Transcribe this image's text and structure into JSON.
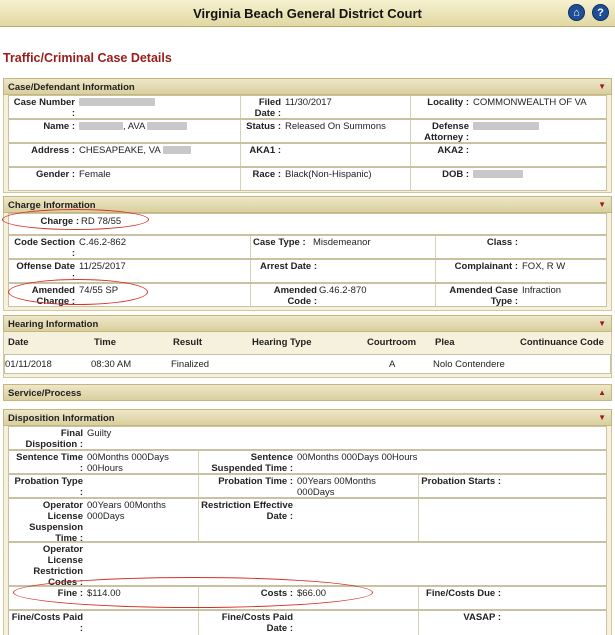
{
  "header": {
    "title": "Virginia Beach General District Court",
    "home_icon": "house-icon",
    "help_icon": "question-icon"
  },
  "page_title": "Traffic/Criminal Case Details",
  "case_section": {
    "title": "Case/Defendant Information",
    "case_number_label": "Case Number :",
    "case_number_value": "",
    "filed_date_label": "Filed Date :",
    "filed_date_value": "11/30/2017",
    "locality_label": "Locality :",
    "locality_value": "COMMONWEALTH OF VA",
    "name_label": "Name :",
    "name_value": ", AVA",
    "status_label": "Status :",
    "status_value": "Released On Summons",
    "defense_attorney_label": "Defense Attorney :",
    "address_label": "Address :",
    "address_value": "CHESAPEAKE, VA",
    "aka1_label": "AKA1 :",
    "aka2_label": "AKA2 :",
    "gender_label": "Gender :",
    "gender_value": "Female",
    "race_label": "Race :",
    "race_value": "Black(Non-Hispanic)",
    "dob_label": "DOB :"
  },
  "charge_section": {
    "title": "Charge Information",
    "charge_label": "Charge :",
    "charge_value": "RD 78/55",
    "code_section_label": "Code Section :",
    "code_section_value": "C.46.2-862",
    "case_type_label": "Case Type :",
    "case_type_value": "Misdemeanor",
    "class_label": "Class :",
    "offense_date_label": "Offense Date :",
    "offense_date_value": "11/25/2017",
    "arrest_date_label": "Arrest Date :",
    "complainant_label": "Complainant :",
    "complainant_value": "FOX, R W",
    "amended_charge_label": "Amended Charge :",
    "amended_charge_value": "74/55 SP",
    "amended_code_label": "Amended Code :",
    "amended_code_value": "G.46.2-870",
    "amended_case_type_label": "Amended Case Type :",
    "amended_case_type_value": "Infraction"
  },
  "hearing_section": {
    "title": "Hearing Information",
    "columns": [
      "Date",
      "Time",
      "Result",
      "Hearing Type",
      "Courtroom",
      "Plea",
      "Continuance Code"
    ],
    "rows": [
      [
        "01/11/2018",
        "08:30 AM",
        "Finalized",
        "",
        "A",
        "Nolo Contendere",
        ""
      ]
    ]
  },
  "service_section": {
    "title": "Service/Process"
  },
  "disposition_section": {
    "title": "Disposition Information",
    "final_disposition_label": "Final Disposition :",
    "final_disposition_value": "Guilty",
    "sentence_time_label": "Sentence Time :",
    "sentence_time_value": "00Months 000Days 00Hours",
    "sentence_suspended_label": "Sentence Suspended Time :",
    "sentence_suspended_value": "00Months 000Days 00Hours",
    "probation_type_label": "Probation Type :",
    "probation_time_label": "Probation Time :",
    "probation_time_value": "00Years 00Months 000Days",
    "probation_starts_label": "Probation Starts :",
    "operator_license_suspension_label": "Operator License Suspension Time :",
    "operator_license_suspension_value": "00Years 00Months 000Days",
    "restriction_effective_label": "Restriction Effective Date :",
    "operator_license_restriction_label": "Operator License Restriction Codes :",
    "fine_label": "Fine :",
    "fine_value": "$114.00",
    "costs_label": "Costs :",
    "costs_value": "$66.00",
    "fine_costs_due_label": "Fine/Costs Due :",
    "fine_costs_paid_label": "Fine/Costs Paid :",
    "fine_costs_paid_date_label": "Fine/Costs Paid Date :",
    "vasap_label": "VASAP :"
  },
  "annotation_color": "#d6302a"
}
